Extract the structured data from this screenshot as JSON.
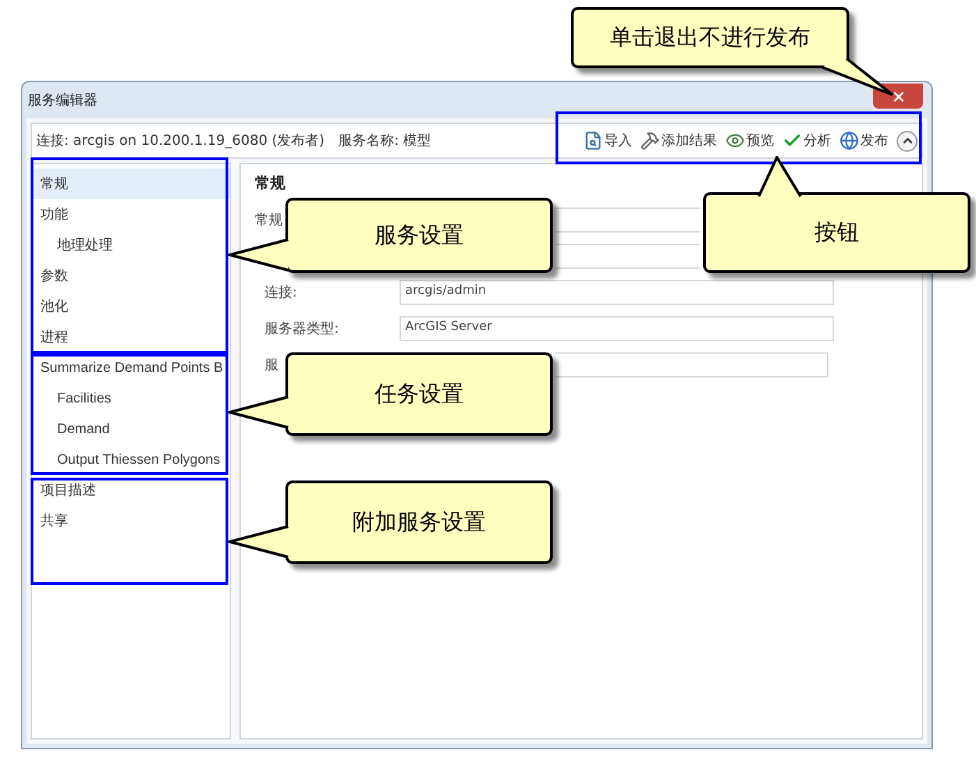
{
  "window": {
    "title": "服务编辑器"
  },
  "info_bar": {
    "connection": "连接: arcgis on 10.200.1.19_6080 (发布者)",
    "service_name": "服务名称: 模型"
  },
  "toolbar": [
    {
      "kind": "import",
      "label": "导入"
    },
    {
      "kind": "add_result",
      "label": "添加结果"
    },
    {
      "kind": "preview",
      "label": "预览"
    },
    {
      "kind": "analyze",
      "label": "分析"
    },
    {
      "kind": "publish",
      "label": "发布"
    },
    {
      "kind": "collapse"
    }
  ],
  "sidebar": {
    "items": [
      {
        "label": "常规",
        "selected": true
      },
      {
        "label": "功能",
        "selected": false,
        "children": [
          {
            "label": "地理处理",
            "selected": false
          }
        ]
      },
      {
        "label": "参数",
        "selected": false
      },
      {
        "label": "池化",
        "selected": false
      },
      {
        "label": "进程",
        "selected": false
      },
      {
        "label": "Summarize Demand Points B",
        "selected": false,
        "children": [
          {
            "label": "Facilities",
            "selected": false
          },
          {
            "label": "Demand",
            "selected": false
          },
          {
            "label": "Output Thiessen Polygons",
            "selected": false
          }
        ]
      },
      {
        "label": "项目描述",
        "selected": false
      },
      {
        "label": "共享",
        "selected": false
      }
    ]
  },
  "panel": {
    "heading": "常规",
    "section": "常规",
    "fields": [
      {
        "kind": "partial"
      },
      {
        "kind": "partial"
      },
      {
        "kind": "full",
        "label": "连接:",
        "value": "arcgis/admin"
      },
      {
        "kind": "full",
        "label": "服务器类型:",
        "value": "ArcGIS Server"
      },
      {
        "kind": "covered",
        "label": "服"
      }
    ]
  },
  "callouts": [
    {
      "text": "单击退出不进行发布"
    },
    {
      "text": "服务设置"
    },
    {
      "text": "按钮"
    },
    {
      "text": "任务设置"
    },
    {
      "text": "附加服务设置"
    }
  ]
}
